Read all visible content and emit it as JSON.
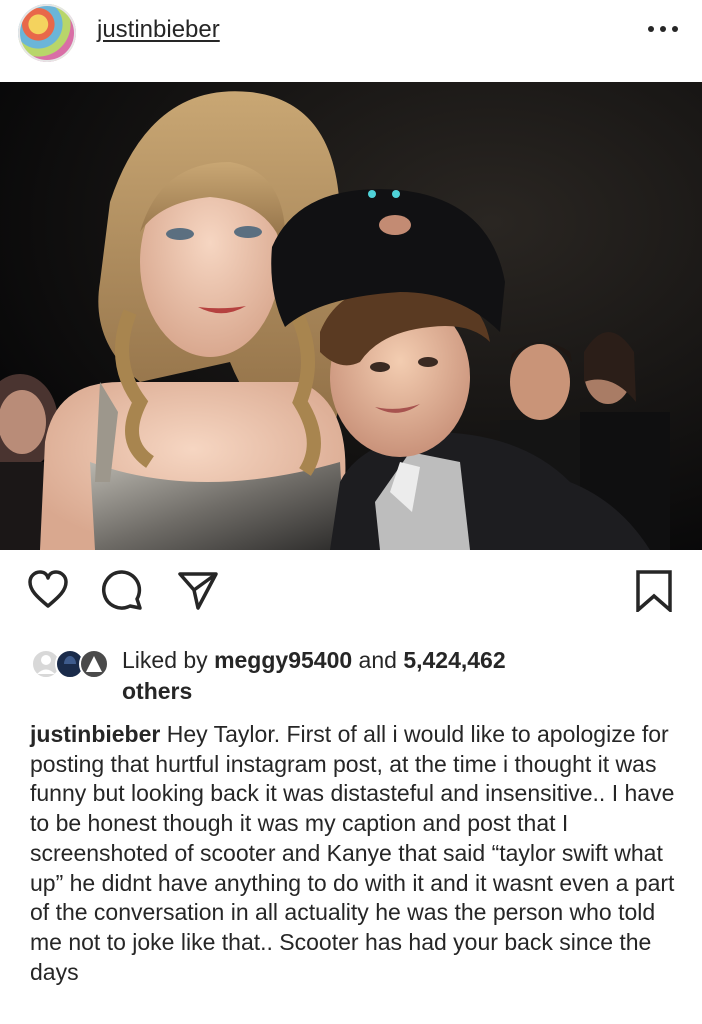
{
  "header": {
    "username": "justinbieber",
    "avatar_icon": "avatar-sticker-collage",
    "more_icon": "more-horizontal-icon"
  },
  "post": {
    "image_alt": "Photo of Taylor Swift and Justin Bieber at an event"
  },
  "actions": {
    "like_icon": "heart-icon",
    "comment_icon": "comment-icon",
    "share_icon": "send-icon",
    "save_icon": "bookmark-icon"
  },
  "likes": {
    "prefix": "Liked by ",
    "user": "meggy95400",
    "middle": " and ",
    "count": "5,424,462",
    "suffix": "others"
  },
  "caption": {
    "username": "justinbieber",
    "text": "Hey Taylor. First of all i would like to apologize for posting that hurtful instagram post, at the time i thought it was funny but looking back it was distasteful and insensitive.. I have to be honest though it was my caption and post that I screenshoted of scooter and Kanye that said “taylor swift what up” he didnt have anything to do with it and it wasnt even a part of the conversation in all actuality he was the person who told me not to joke like that.. Scooter has had your back since the days"
  }
}
